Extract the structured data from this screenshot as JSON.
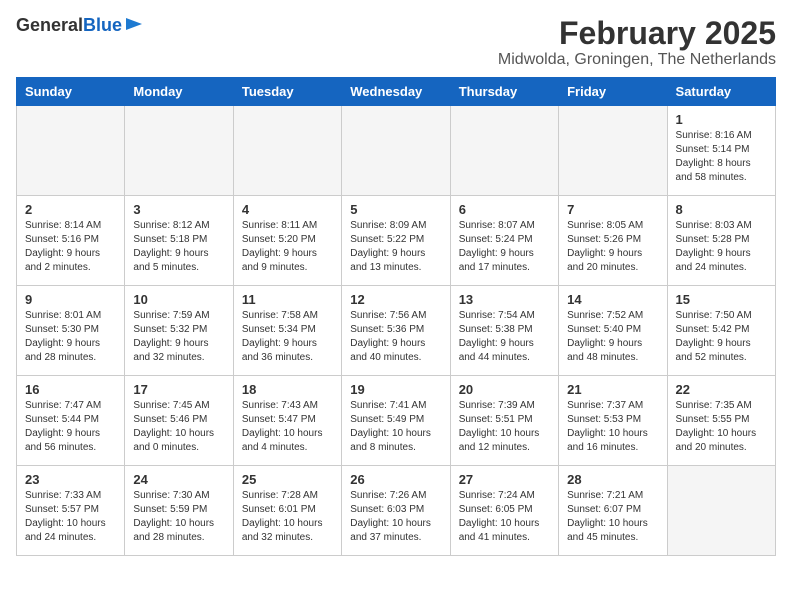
{
  "logo": {
    "line1": "General",
    "line2": "Blue"
  },
  "title": "February 2025",
  "subtitle": "Midwolda, Groningen, The Netherlands",
  "weekdays": [
    "Sunday",
    "Monday",
    "Tuesday",
    "Wednesday",
    "Thursday",
    "Friday",
    "Saturday"
  ],
  "weeks": [
    [
      {
        "day": "",
        "info": ""
      },
      {
        "day": "",
        "info": ""
      },
      {
        "day": "",
        "info": ""
      },
      {
        "day": "",
        "info": ""
      },
      {
        "day": "",
        "info": ""
      },
      {
        "day": "",
        "info": ""
      },
      {
        "day": "1",
        "info": "Sunrise: 8:16 AM\nSunset: 5:14 PM\nDaylight: 8 hours and 58 minutes."
      }
    ],
    [
      {
        "day": "2",
        "info": "Sunrise: 8:14 AM\nSunset: 5:16 PM\nDaylight: 9 hours and 2 minutes."
      },
      {
        "day": "3",
        "info": "Sunrise: 8:12 AM\nSunset: 5:18 PM\nDaylight: 9 hours and 5 minutes."
      },
      {
        "day": "4",
        "info": "Sunrise: 8:11 AM\nSunset: 5:20 PM\nDaylight: 9 hours and 9 minutes."
      },
      {
        "day": "5",
        "info": "Sunrise: 8:09 AM\nSunset: 5:22 PM\nDaylight: 9 hours and 13 minutes."
      },
      {
        "day": "6",
        "info": "Sunrise: 8:07 AM\nSunset: 5:24 PM\nDaylight: 9 hours and 17 minutes."
      },
      {
        "day": "7",
        "info": "Sunrise: 8:05 AM\nSunset: 5:26 PM\nDaylight: 9 hours and 20 minutes."
      },
      {
        "day": "8",
        "info": "Sunrise: 8:03 AM\nSunset: 5:28 PM\nDaylight: 9 hours and 24 minutes."
      }
    ],
    [
      {
        "day": "9",
        "info": "Sunrise: 8:01 AM\nSunset: 5:30 PM\nDaylight: 9 hours and 28 minutes."
      },
      {
        "day": "10",
        "info": "Sunrise: 7:59 AM\nSunset: 5:32 PM\nDaylight: 9 hours and 32 minutes."
      },
      {
        "day": "11",
        "info": "Sunrise: 7:58 AM\nSunset: 5:34 PM\nDaylight: 9 hours and 36 minutes."
      },
      {
        "day": "12",
        "info": "Sunrise: 7:56 AM\nSunset: 5:36 PM\nDaylight: 9 hours and 40 minutes."
      },
      {
        "day": "13",
        "info": "Sunrise: 7:54 AM\nSunset: 5:38 PM\nDaylight: 9 hours and 44 minutes."
      },
      {
        "day": "14",
        "info": "Sunrise: 7:52 AM\nSunset: 5:40 PM\nDaylight: 9 hours and 48 minutes."
      },
      {
        "day": "15",
        "info": "Sunrise: 7:50 AM\nSunset: 5:42 PM\nDaylight: 9 hours and 52 minutes."
      }
    ],
    [
      {
        "day": "16",
        "info": "Sunrise: 7:47 AM\nSunset: 5:44 PM\nDaylight: 9 hours and 56 minutes."
      },
      {
        "day": "17",
        "info": "Sunrise: 7:45 AM\nSunset: 5:46 PM\nDaylight: 10 hours and 0 minutes."
      },
      {
        "day": "18",
        "info": "Sunrise: 7:43 AM\nSunset: 5:47 PM\nDaylight: 10 hours and 4 minutes."
      },
      {
        "day": "19",
        "info": "Sunrise: 7:41 AM\nSunset: 5:49 PM\nDaylight: 10 hours and 8 minutes."
      },
      {
        "day": "20",
        "info": "Sunrise: 7:39 AM\nSunset: 5:51 PM\nDaylight: 10 hours and 12 minutes."
      },
      {
        "day": "21",
        "info": "Sunrise: 7:37 AM\nSunset: 5:53 PM\nDaylight: 10 hours and 16 minutes."
      },
      {
        "day": "22",
        "info": "Sunrise: 7:35 AM\nSunset: 5:55 PM\nDaylight: 10 hours and 20 minutes."
      }
    ],
    [
      {
        "day": "23",
        "info": "Sunrise: 7:33 AM\nSunset: 5:57 PM\nDaylight: 10 hours and 24 minutes."
      },
      {
        "day": "24",
        "info": "Sunrise: 7:30 AM\nSunset: 5:59 PM\nDaylight: 10 hours and 28 minutes."
      },
      {
        "day": "25",
        "info": "Sunrise: 7:28 AM\nSunset: 6:01 PM\nDaylight: 10 hours and 32 minutes."
      },
      {
        "day": "26",
        "info": "Sunrise: 7:26 AM\nSunset: 6:03 PM\nDaylight: 10 hours and 37 minutes."
      },
      {
        "day": "27",
        "info": "Sunrise: 7:24 AM\nSunset: 6:05 PM\nDaylight: 10 hours and 41 minutes."
      },
      {
        "day": "28",
        "info": "Sunrise: 7:21 AM\nSunset: 6:07 PM\nDaylight: 10 hours and 45 minutes."
      },
      {
        "day": "",
        "info": ""
      }
    ]
  ]
}
